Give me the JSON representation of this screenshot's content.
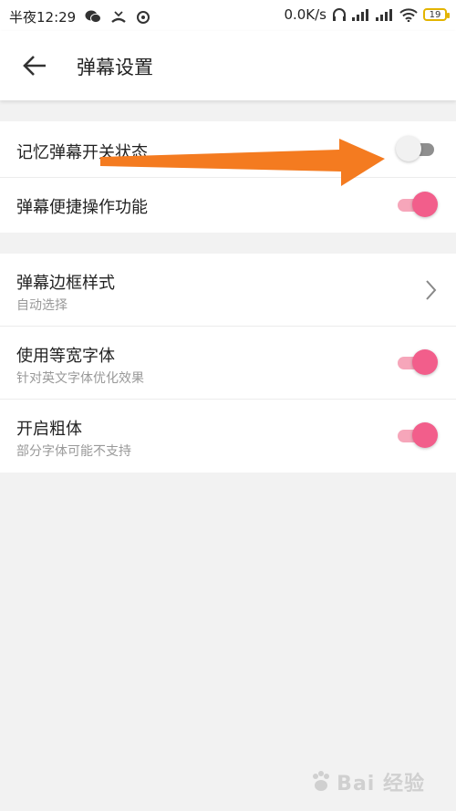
{
  "status_bar": {
    "time": "半夜12:29",
    "net_speed": "0.0K/s",
    "battery": "19"
  },
  "header": {
    "title": "弹幕设置"
  },
  "settings": {
    "group1": [
      {
        "title": "记忆弹幕开关状态",
        "enabled": false
      },
      {
        "title": "弹幕便捷操作功能",
        "enabled": true
      }
    ],
    "group2": [
      {
        "title": "弹幕边框样式",
        "subtitle": "自动选择",
        "control": "chevron"
      },
      {
        "title": "使用等宽字体",
        "subtitle": "针对英文字体优化效果",
        "enabled": true
      },
      {
        "title": "开启粗体",
        "subtitle": "部分字体可能不支持",
        "enabled": true
      }
    ]
  },
  "annotation": {
    "arrow_color": "#f47b20"
  },
  "colors": {
    "accent": "#f25e8b",
    "accent_track": "#f6a6ba",
    "off_track": "#8f8f8f",
    "background": "#f2f2f2"
  },
  "watermark": {
    "text": "Bai 经验"
  }
}
